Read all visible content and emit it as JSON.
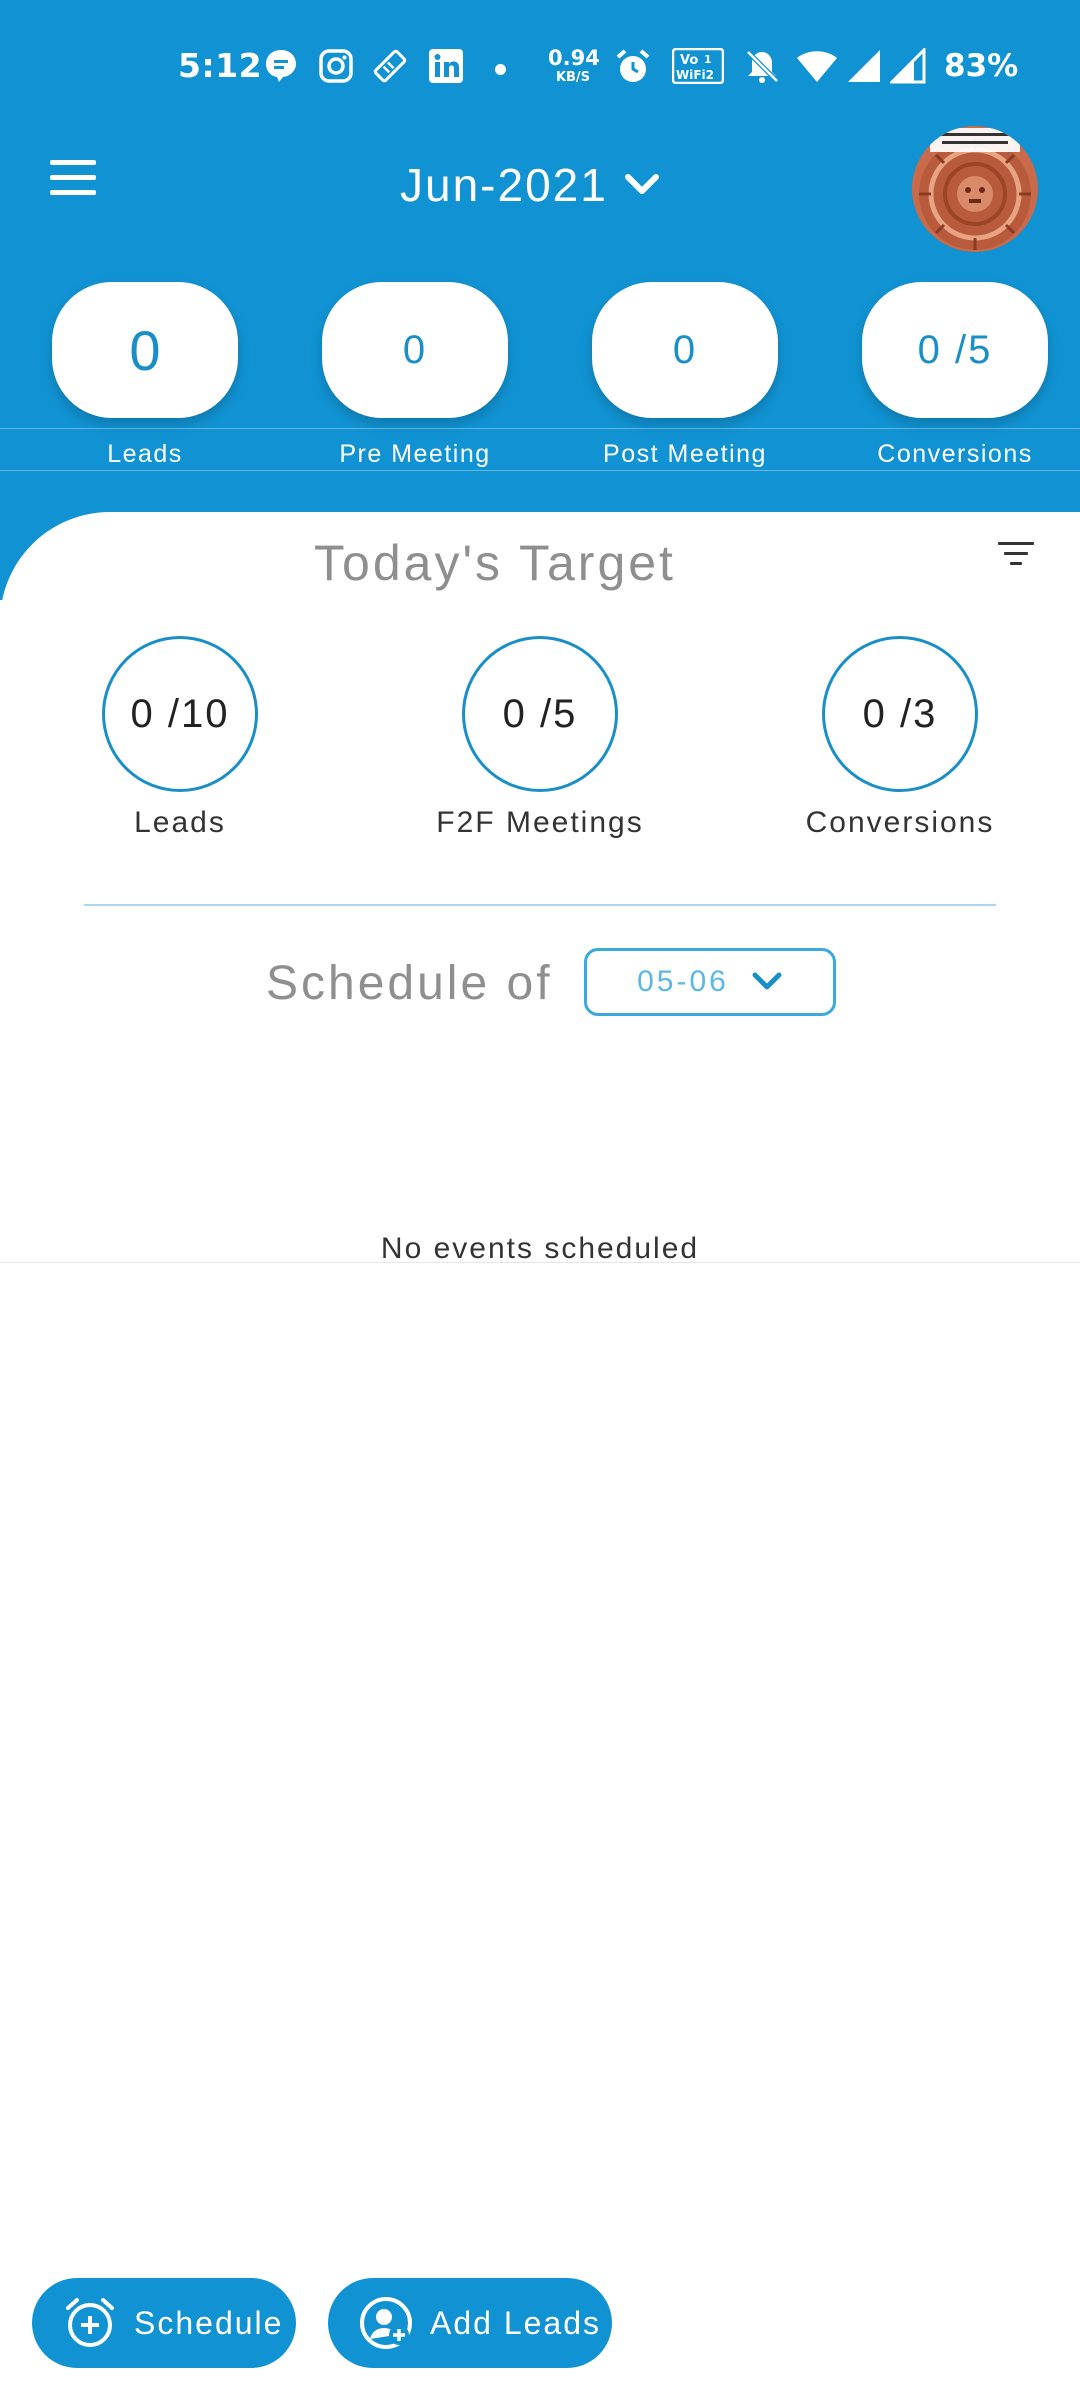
{
  "status_bar": {
    "time": "5:12",
    "net_speed_value": "0.94",
    "net_speed_unit": "KB/S",
    "vowifi_label": "Vo",
    "battery": "83%"
  },
  "header": {
    "month": "Jun-2021",
    "avatar_caption": "Aztec calendar avatar"
  },
  "stats": [
    {
      "value": "0",
      "label": "Leads"
    },
    {
      "value": "0",
      "label": "Pre Meeting"
    },
    {
      "value": "0",
      "label": "Post Meeting"
    },
    {
      "value": "0 /5",
      "label": "Conversions"
    }
  ],
  "today_target": {
    "title": "Today's Target",
    "items": [
      {
        "value": "0 /10",
        "label": "Leads"
      },
      {
        "value": "0 /5",
        "label": "F2F Meetings"
      },
      {
        "value": "0 /3",
        "label": "Conversions"
      }
    ]
  },
  "schedule": {
    "label": "Schedule of",
    "date": "05-06",
    "empty_message": "No events scheduled"
  },
  "actions": {
    "schedule_label": "Schedule",
    "add_leads_label": "Add Leads"
  },
  "colors": {
    "primary_blue": "#1193d3",
    "accent_text": "#1a8fc7",
    "divider": "#a6d8ef"
  }
}
